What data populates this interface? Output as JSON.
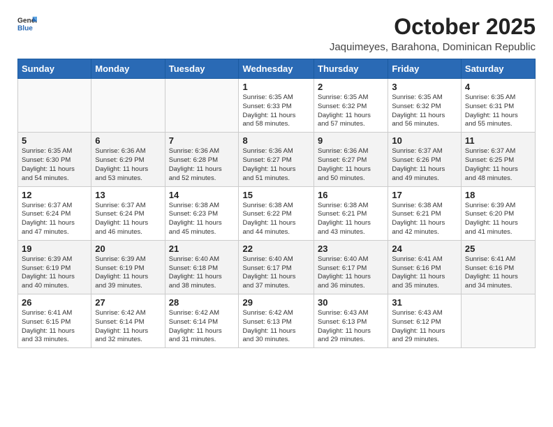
{
  "logo": {
    "general": "General",
    "blue": "Blue"
  },
  "title": "October 2025",
  "location": "Jaquimeyes, Barahona, Dominican Republic",
  "days_header": [
    "Sunday",
    "Monday",
    "Tuesday",
    "Wednesday",
    "Thursday",
    "Friday",
    "Saturday"
  ],
  "weeks": [
    [
      {
        "day": "",
        "info": ""
      },
      {
        "day": "",
        "info": ""
      },
      {
        "day": "",
        "info": ""
      },
      {
        "day": "1",
        "info": "Sunrise: 6:35 AM\nSunset: 6:33 PM\nDaylight: 11 hours\nand 58 minutes."
      },
      {
        "day": "2",
        "info": "Sunrise: 6:35 AM\nSunset: 6:32 PM\nDaylight: 11 hours\nand 57 minutes."
      },
      {
        "day": "3",
        "info": "Sunrise: 6:35 AM\nSunset: 6:32 PM\nDaylight: 11 hours\nand 56 minutes."
      },
      {
        "day": "4",
        "info": "Sunrise: 6:35 AM\nSunset: 6:31 PM\nDaylight: 11 hours\nand 55 minutes."
      }
    ],
    [
      {
        "day": "5",
        "info": "Sunrise: 6:35 AM\nSunset: 6:30 PM\nDaylight: 11 hours\nand 54 minutes."
      },
      {
        "day": "6",
        "info": "Sunrise: 6:36 AM\nSunset: 6:29 PM\nDaylight: 11 hours\nand 53 minutes."
      },
      {
        "day": "7",
        "info": "Sunrise: 6:36 AM\nSunset: 6:28 PM\nDaylight: 11 hours\nand 52 minutes."
      },
      {
        "day": "8",
        "info": "Sunrise: 6:36 AM\nSunset: 6:27 PM\nDaylight: 11 hours\nand 51 minutes."
      },
      {
        "day": "9",
        "info": "Sunrise: 6:36 AM\nSunset: 6:27 PM\nDaylight: 11 hours\nand 50 minutes."
      },
      {
        "day": "10",
        "info": "Sunrise: 6:37 AM\nSunset: 6:26 PM\nDaylight: 11 hours\nand 49 minutes."
      },
      {
        "day": "11",
        "info": "Sunrise: 6:37 AM\nSunset: 6:25 PM\nDaylight: 11 hours\nand 48 minutes."
      }
    ],
    [
      {
        "day": "12",
        "info": "Sunrise: 6:37 AM\nSunset: 6:24 PM\nDaylight: 11 hours\nand 47 minutes."
      },
      {
        "day": "13",
        "info": "Sunrise: 6:37 AM\nSunset: 6:24 PM\nDaylight: 11 hours\nand 46 minutes."
      },
      {
        "day": "14",
        "info": "Sunrise: 6:38 AM\nSunset: 6:23 PM\nDaylight: 11 hours\nand 45 minutes."
      },
      {
        "day": "15",
        "info": "Sunrise: 6:38 AM\nSunset: 6:22 PM\nDaylight: 11 hours\nand 44 minutes."
      },
      {
        "day": "16",
        "info": "Sunrise: 6:38 AM\nSunset: 6:21 PM\nDaylight: 11 hours\nand 43 minutes."
      },
      {
        "day": "17",
        "info": "Sunrise: 6:38 AM\nSunset: 6:21 PM\nDaylight: 11 hours\nand 42 minutes."
      },
      {
        "day": "18",
        "info": "Sunrise: 6:39 AM\nSunset: 6:20 PM\nDaylight: 11 hours\nand 41 minutes."
      }
    ],
    [
      {
        "day": "19",
        "info": "Sunrise: 6:39 AM\nSunset: 6:19 PM\nDaylight: 11 hours\nand 40 minutes."
      },
      {
        "day": "20",
        "info": "Sunrise: 6:39 AM\nSunset: 6:19 PM\nDaylight: 11 hours\nand 39 minutes."
      },
      {
        "day": "21",
        "info": "Sunrise: 6:40 AM\nSunset: 6:18 PM\nDaylight: 11 hours\nand 38 minutes."
      },
      {
        "day": "22",
        "info": "Sunrise: 6:40 AM\nSunset: 6:17 PM\nDaylight: 11 hours\nand 37 minutes."
      },
      {
        "day": "23",
        "info": "Sunrise: 6:40 AM\nSunset: 6:17 PM\nDaylight: 11 hours\nand 36 minutes."
      },
      {
        "day": "24",
        "info": "Sunrise: 6:41 AM\nSunset: 6:16 PM\nDaylight: 11 hours\nand 35 minutes."
      },
      {
        "day": "25",
        "info": "Sunrise: 6:41 AM\nSunset: 6:16 PM\nDaylight: 11 hours\nand 34 minutes."
      }
    ],
    [
      {
        "day": "26",
        "info": "Sunrise: 6:41 AM\nSunset: 6:15 PM\nDaylight: 11 hours\nand 33 minutes."
      },
      {
        "day": "27",
        "info": "Sunrise: 6:42 AM\nSunset: 6:14 PM\nDaylight: 11 hours\nand 32 minutes."
      },
      {
        "day": "28",
        "info": "Sunrise: 6:42 AM\nSunset: 6:14 PM\nDaylight: 11 hours\nand 31 minutes."
      },
      {
        "day": "29",
        "info": "Sunrise: 6:42 AM\nSunset: 6:13 PM\nDaylight: 11 hours\nand 30 minutes."
      },
      {
        "day": "30",
        "info": "Sunrise: 6:43 AM\nSunset: 6:13 PM\nDaylight: 11 hours\nand 29 minutes."
      },
      {
        "day": "31",
        "info": "Sunrise: 6:43 AM\nSunset: 6:12 PM\nDaylight: 11 hours\nand 29 minutes."
      },
      {
        "day": "",
        "info": ""
      }
    ]
  ]
}
